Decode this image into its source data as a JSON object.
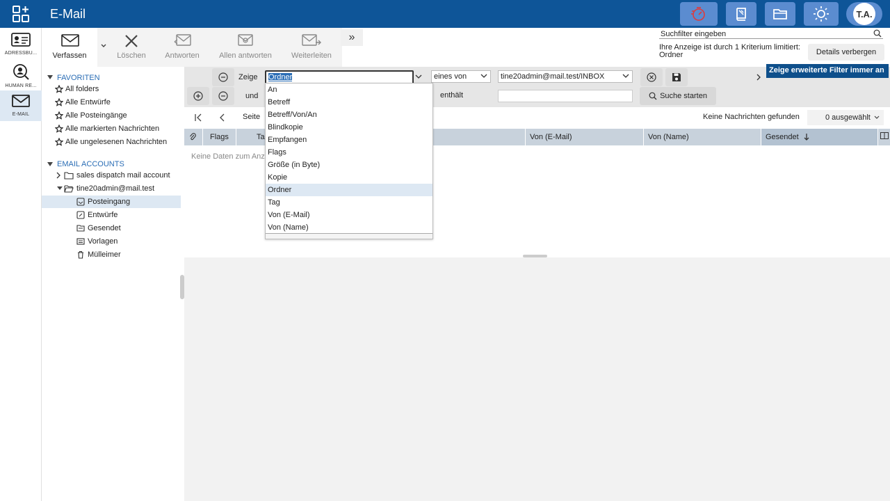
{
  "app": {
    "title": "E-Mail",
    "avatar": "T.A."
  },
  "rail": {
    "items": [
      {
        "label": "ADRESSBU..."
      },
      {
        "label": "HUMAN RE..."
      },
      {
        "label": "E-MAIL"
      }
    ]
  },
  "toolbar": {
    "compose": "Verfassen",
    "delete": "Löschen",
    "reply": "Antworten",
    "reply_all": "Allen antworten",
    "forward": "Weiterleiten"
  },
  "search": {
    "placeholder": "Suchfilter eingeben",
    "filter_info": "Ihre Anzeige ist durch 1 Kriterium limitiert:",
    "filter_value": "Ordner",
    "details_button": "Details verbergen"
  },
  "tree": {
    "favorites_head": "FAVORITEN",
    "favorites": [
      "All folders",
      "Alle Entwürfe",
      "Alle Posteingänge",
      "Alle markierten Nachrichten",
      "Alle ungelesenen Nachrichten"
    ],
    "accounts_head": "EMAIL ACCOUNTS",
    "accounts": [
      "sales dispatch mail account",
      "tine20admin@mail.test"
    ],
    "folders": [
      "Posteingang",
      "Entwürfe",
      "Gesendet",
      "Vorlagen",
      "Mülleimer"
    ]
  },
  "filter": {
    "show_label": "Zeige",
    "field_value": "Ordner",
    "operator": "eines von",
    "value": "tine20admin@mail.test/INBOX",
    "and_label": "und",
    "contains_label": "enthält",
    "search_button": "Suche starten",
    "tooltip": "Zeige erweiterte Filter immer an"
  },
  "paging": {
    "page_label": "Seite",
    "no_results": "Keine Nachrichten gefunden",
    "selected": "0 ausgewählt"
  },
  "grid": {
    "columns": [
      "Flags",
      "Ta",
      "Von (E-Mail)",
      "Von (Name)",
      "Gesendet"
    ],
    "empty": "Keine Daten zum Anz"
  },
  "dropdown": {
    "options": [
      "An",
      "Betreff",
      "Betreff/Von/An",
      "Blindkopie",
      "Empfangen",
      "Flags",
      "Größe (in Byte)",
      "Kopie",
      "Ordner",
      "Tag",
      "Von (E-Mail)",
      "Von (Name)"
    ],
    "highlighted": "Ordner"
  },
  "colors": {
    "topbar": "#0e5598",
    "accent": "#2a6db5",
    "topbutton": "#5b8cd0"
  }
}
